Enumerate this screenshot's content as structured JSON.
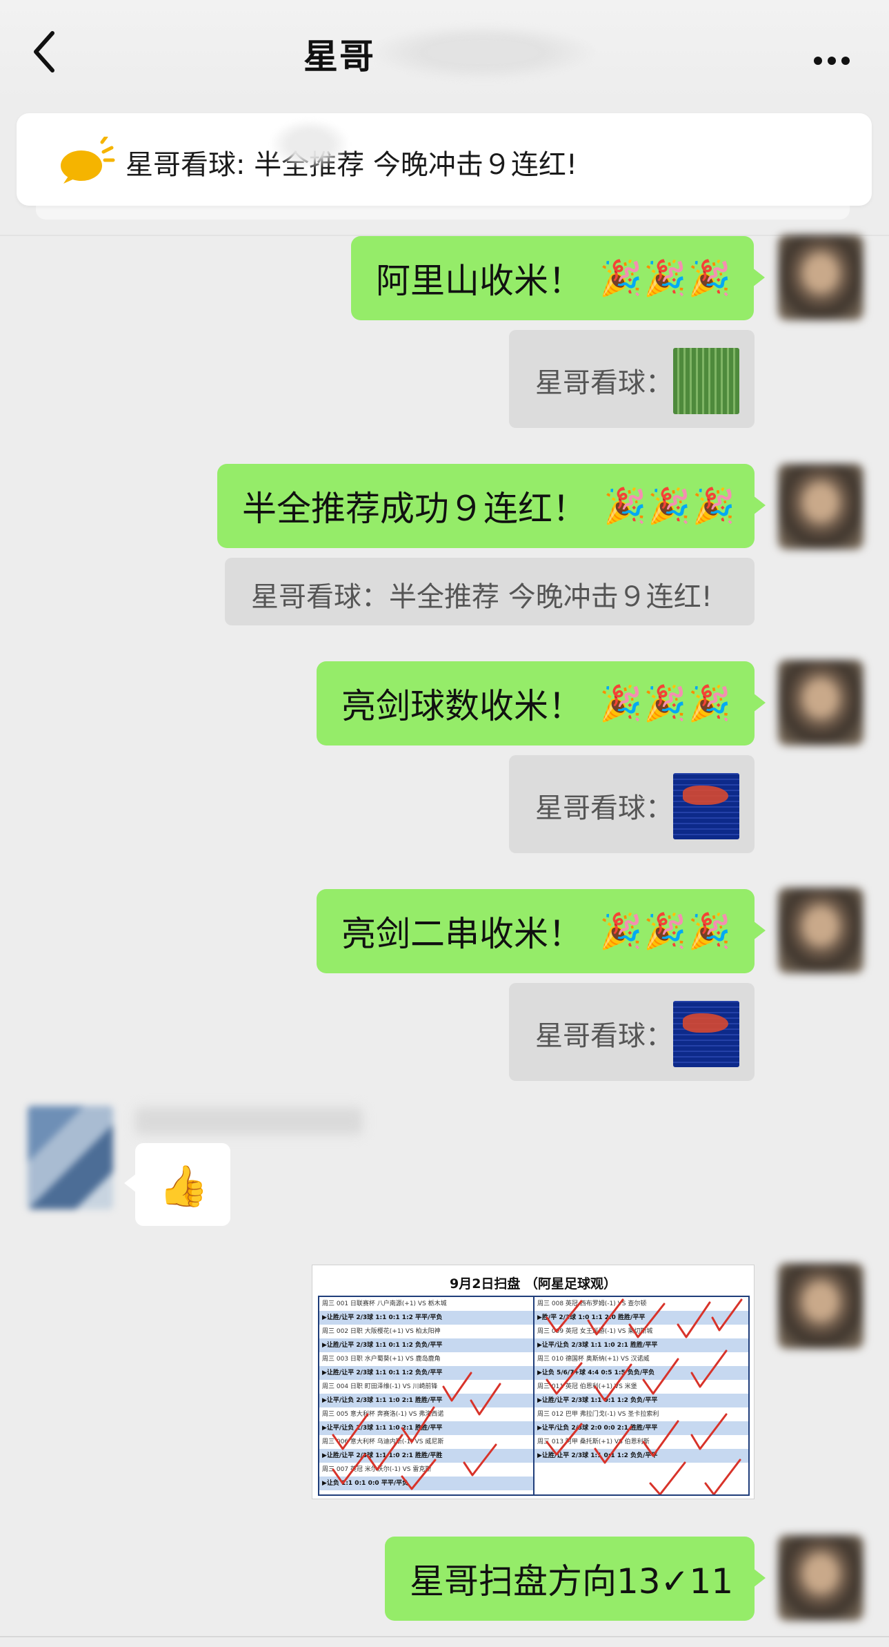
{
  "header": {
    "title": "星哥",
    "back_label": "‹",
    "more_label": "more"
  },
  "pinned": {
    "text": "星哥看球: 半全推荐 今晚冲击９连红!"
  },
  "messages": [
    {
      "type": "outgoing",
      "text": "阿里山收米！",
      "emoji": "🎉🎉🎉"
    },
    {
      "type": "quote",
      "text": "星哥看球："
    },
    {
      "type": "outgoing",
      "text": "半全推荐成功９连红！",
      "emoji": "🎉🎉🎉"
    },
    {
      "type": "quote",
      "text": "星哥看球：半全推荐 今晚冲击９连红!"
    },
    {
      "type": "outgoing",
      "text": "亮剑球数收米！",
      "emoji": "🎉🎉🎉"
    },
    {
      "type": "quote",
      "text": "星哥看球："
    },
    {
      "type": "outgoing",
      "text": "亮剑二串收米！",
      "emoji": "🎉🎉🎉"
    },
    {
      "type": "quote",
      "text": "星哥看球："
    },
    {
      "type": "incoming",
      "emoji": "👍"
    },
    {
      "type": "outgoing",
      "text": "星哥扫盘方向13✓11"
    }
  ],
  "sheet": {
    "title": "9月2日扫盘 （阿星足球观）",
    "left_rows": [
      {
        "text": "周三 001 日联赛杯 八户南源(+1) VS 栃木城",
        "bold": false
      },
      {
        "text": "▶让胜/让平      2/3球    1:1    0:1    1:2      平平/平负",
        "bold": true
      },
      {
        "text": "周三 002 日职 大阪樱花(+1) VS 柏太阳神",
        "bold": false
      },
      {
        "text": "▶让胜/让平      2/3球    1:1    0:1    1:2      负负/平平",
        "bold": true
      },
      {
        "text": "周三 003 日职 水户蜀葵(+1) VS 鹿岛鹿角",
        "bold": false
      },
      {
        "text": "▶让胜/让平      2/3球    1:1    0:1    1:2      负负/平平",
        "bold": true
      },
      {
        "text": "周三 004 日职 町田泽维(-1) VS 川崎前锋",
        "bold": false
      },
      {
        "text": "▶让平/让负      2/3球    1:1    1:0    2:1      胜胜/平平",
        "bold": true
      },
      {
        "text": "周三 005 意大利杯 奔赛洛(-1) VS 弗洛西诺",
        "bold": false
      },
      {
        "text": "▶让平/让负      2/3球    1:1    1:0    2:1      胜胜/平平",
        "bold": true
      },
      {
        "text": "周三 006 意大利杯 乌迪内斯(-1) VS 威尼斯",
        "bold": false
      },
      {
        "text": "▶让胜/让平      2/3球    1:1    1:0    2:1      胜胜/平胜",
        "bold": true
      },
      {
        "text": "周三 007 英冠 米尔沃尔(-1) VS 雷克斯",
        "bold": false
      },
      {
        "text": "▶让负              1:1    0:1    0:0      平平/平负",
        "bold": true
      }
    ],
    "right_rows": [
      {
        "text": "周三 008 英冠 西布罗姆(-1) VS 查尔顿",
        "bold": false
      },
      {
        "text": "▶胜/平          2/3球    1:0    1:1    2:0      胜胜/平平",
        "bold": true
      },
      {
        "text": "周三 009 英冠 女王巡游(-1) VS 莱切斯城",
        "bold": false
      },
      {
        "text": "▶让平/让负      2/3球    1:1    1:0    2:1      胜胜/平平",
        "bold": true
      },
      {
        "text": "周三 010 德国杯 奥斯纳(+1) VS 汉诺威",
        "bold": false
      },
      {
        "text": "▶让负          5/6/7+球  4:4    0:5    1:5      负负/平负",
        "bold": true
      },
      {
        "text": "周三 011 英冠 伯恩利(+1) VS 米堡",
        "bold": false
      },
      {
        "text": "▶让胜/让平      2/3球    1:1    0:1    1:2      负负/平平",
        "bold": true
      },
      {
        "text": "周三 012 巴甲 弗拉门戈(-1) VS 圣卡拉索利",
        "bold": false
      },
      {
        "text": "▶让平/让负      2/3球    2:0    0:0    2:1      胜胜/平平",
        "bold": true
      },
      {
        "text": "周三 013 阿甲 桑托斯(+1) VS 伯恩利斯",
        "bold": false
      },
      {
        "text": "▶让胜/让平      2/3球    1:1    0:1    1:2      负负/平平",
        "bold": true
      }
    ]
  },
  "colors": {
    "outgoing_bubble": "#95ec69",
    "quote_bubble": "#dcdcdc",
    "background": "#ededed"
  }
}
